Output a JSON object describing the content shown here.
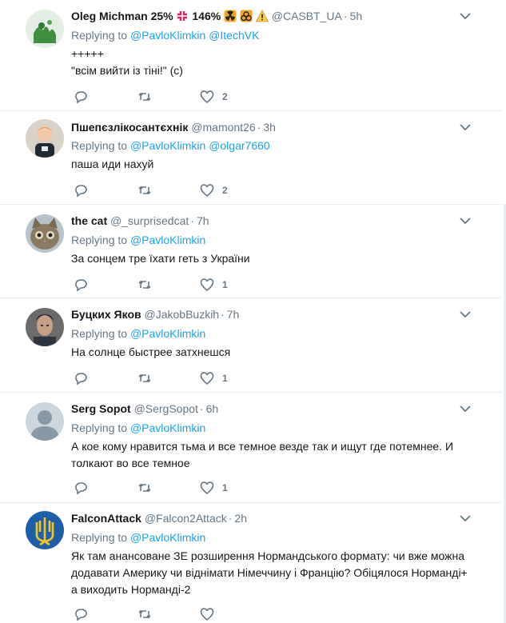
{
  "icons": {
    "reply": "reply-icon",
    "retweet": "retweet-icon",
    "like": "like-icon",
    "menu": "chevron-down-icon"
  },
  "colors": {
    "link": "#1da1f2",
    "secondary": "#657786",
    "border": "#e6ecf0",
    "text": "#14171a"
  },
  "tweets": [
    {
      "name": "Oleg Michman 25%",
      "name_extra": "146%",
      "handle": "@CASBT_UA",
      "time": "5h",
      "replying_label": "Replying to",
      "replying_to": [
        "@PavloKlimkin",
        "@ItechVK"
      ],
      "lines": [
        "+++++",
        "\"всім вийти із тіні!\" (с)"
      ],
      "likes": "2"
    },
    {
      "name": "Пшепєзлікосантєхнік",
      "handle": "@mamont26",
      "time": "3h",
      "replying_label": "Replying to",
      "replying_to": [
        "@PavloKlimkin",
        "@olgar7660"
      ],
      "lines": [
        "паша иди нахуй"
      ],
      "likes": "2"
    },
    {
      "name": "the cat",
      "handle": "@_surprisedcat",
      "time": "7h",
      "replying_label": "Replying to",
      "replying_to": [
        "@PavloKlimkin"
      ],
      "lines": [
        "За сонцем тре їхати геть з України"
      ],
      "likes": "1"
    },
    {
      "name": "Буцких Яков",
      "handle": "@JakobBuzkih",
      "time": "7h",
      "replying_label": "Replying to",
      "replying_to": [
        "@PavloKlimkin"
      ],
      "lines": [
        "На солнце быстрее затхнешся"
      ],
      "likes": "1"
    },
    {
      "name": "Serg Sopot",
      "handle": "@SergSopot",
      "time": "6h",
      "replying_label": "Replying to",
      "replying_to": [
        "@PavloKlimkin"
      ],
      "lines": [
        "А кое кому нравится тьма и все темное везде так и ищут где потемнее. И",
        "толкают во все темное"
      ],
      "likes": "1"
    },
    {
      "name": "FalconAttack",
      "handle": "@Falcon2Attack",
      "time": "2h",
      "replying_label": "Replying to",
      "replying_to": [
        "@PavloKlimkin"
      ],
      "lines": [
        "Як там анансоване ЗЕ розширення Нормандського формату: чи вже можна",
        "додавати Америку чи віднімати Німеччину і Францію? Обіцялося Норманді+",
        "а виходить Норманді-2"
      ],
      "likes": ""
    }
  ]
}
